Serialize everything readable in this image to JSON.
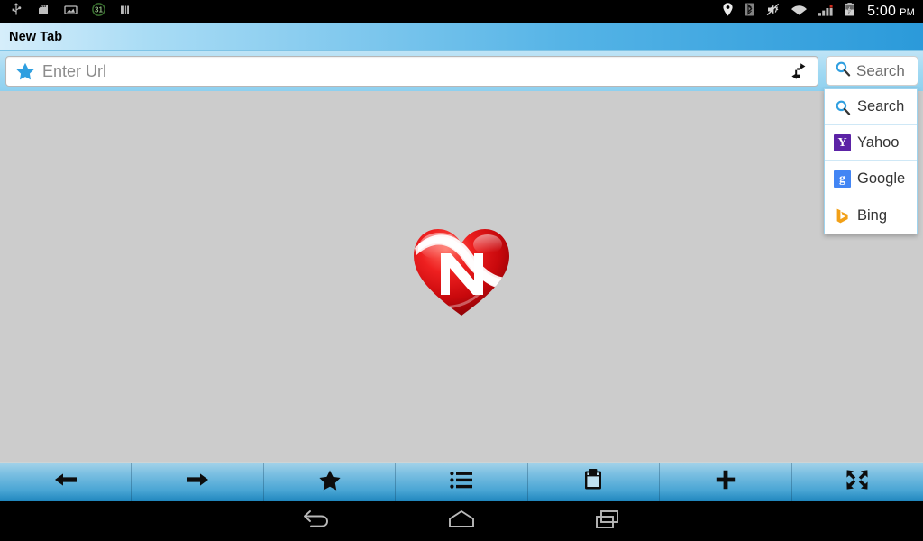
{
  "status_bar": {
    "icons_left": [
      "usb-icon",
      "sd-card-icon",
      "screenshot-icon",
      "calendar-31-icon",
      "sim-icon"
    ],
    "calendar_day": "31",
    "icons_right": [
      "location-icon",
      "bluetooth-icon",
      "mute-icon",
      "wifi-icon",
      "signal-icon",
      "battery-charging-icon"
    ],
    "time": "5:00",
    "ampm": "PM"
  },
  "title_bar": {
    "tab_title": "New Tab"
  },
  "url_bar": {
    "bookmark_icon": "star-icon",
    "placeholder": "Enter Url",
    "value": "",
    "refresh_icon": "refresh-icon"
  },
  "search_button": {
    "label": "Search",
    "icon": "magnifier-icon"
  },
  "engine_menu": {
    "items": [
      {
        "label": "Search",
        "icon": "magnifier-icon"
      },
      {
        "label": "Yahoo",
        "icon": "yahoo-icon",
        "glyph": "Y"
      },
      {
        "label": "Google",
        "icon": "google-icon",
        "glyph": "g"
      },
      {
        "label": "Bing",
        "icon": "bing-icon",
        "glyph": "b"
      }
    ]
  },
  "content": {
    "logo_name": "heart-n-logo",
    "logo_letter": "N"
  },
  "toolbar": {
    "buttons": [
      {
        "name": "back-button",
        "icon": "arrow-left-icon"
      },
      {
        "name": "forward-button",
        "icon": "arrow-right-icon"
      },
      {
        "name": "bookmarks-button",
        "icon": "star-icon"
      },
      {
        "name": "menu-button",
        "icon": "list-icon"
      },
      {
        "name": "notes-button",
        "icon": "clipboard-icon"
      },
      {
        "name": "new-tab-button",
        "icon": "plus-icon"
      },
      {
        "name": "fullscreen-button",
        "icon": "expand-icon"
      }
    ]
  },
  "nav_bar": {
    "buttons": [
      {
        "name": "android-back-button",
        "icon": "back-arrow-icon"
      },
      {
        "name": "android-home-button",
        "icon": "home-icon"
      },
      {
        "name": "android-recents-button",
        "icon": "recents-icon"
      }
    ]
  },
  "colors": {
    "accent_blue": "#2b9ada",
    "content_gray": "#cccccc",
    "logo_red": "#d4121a",
    "star_blue": "#2f9fe0"
  }
}
